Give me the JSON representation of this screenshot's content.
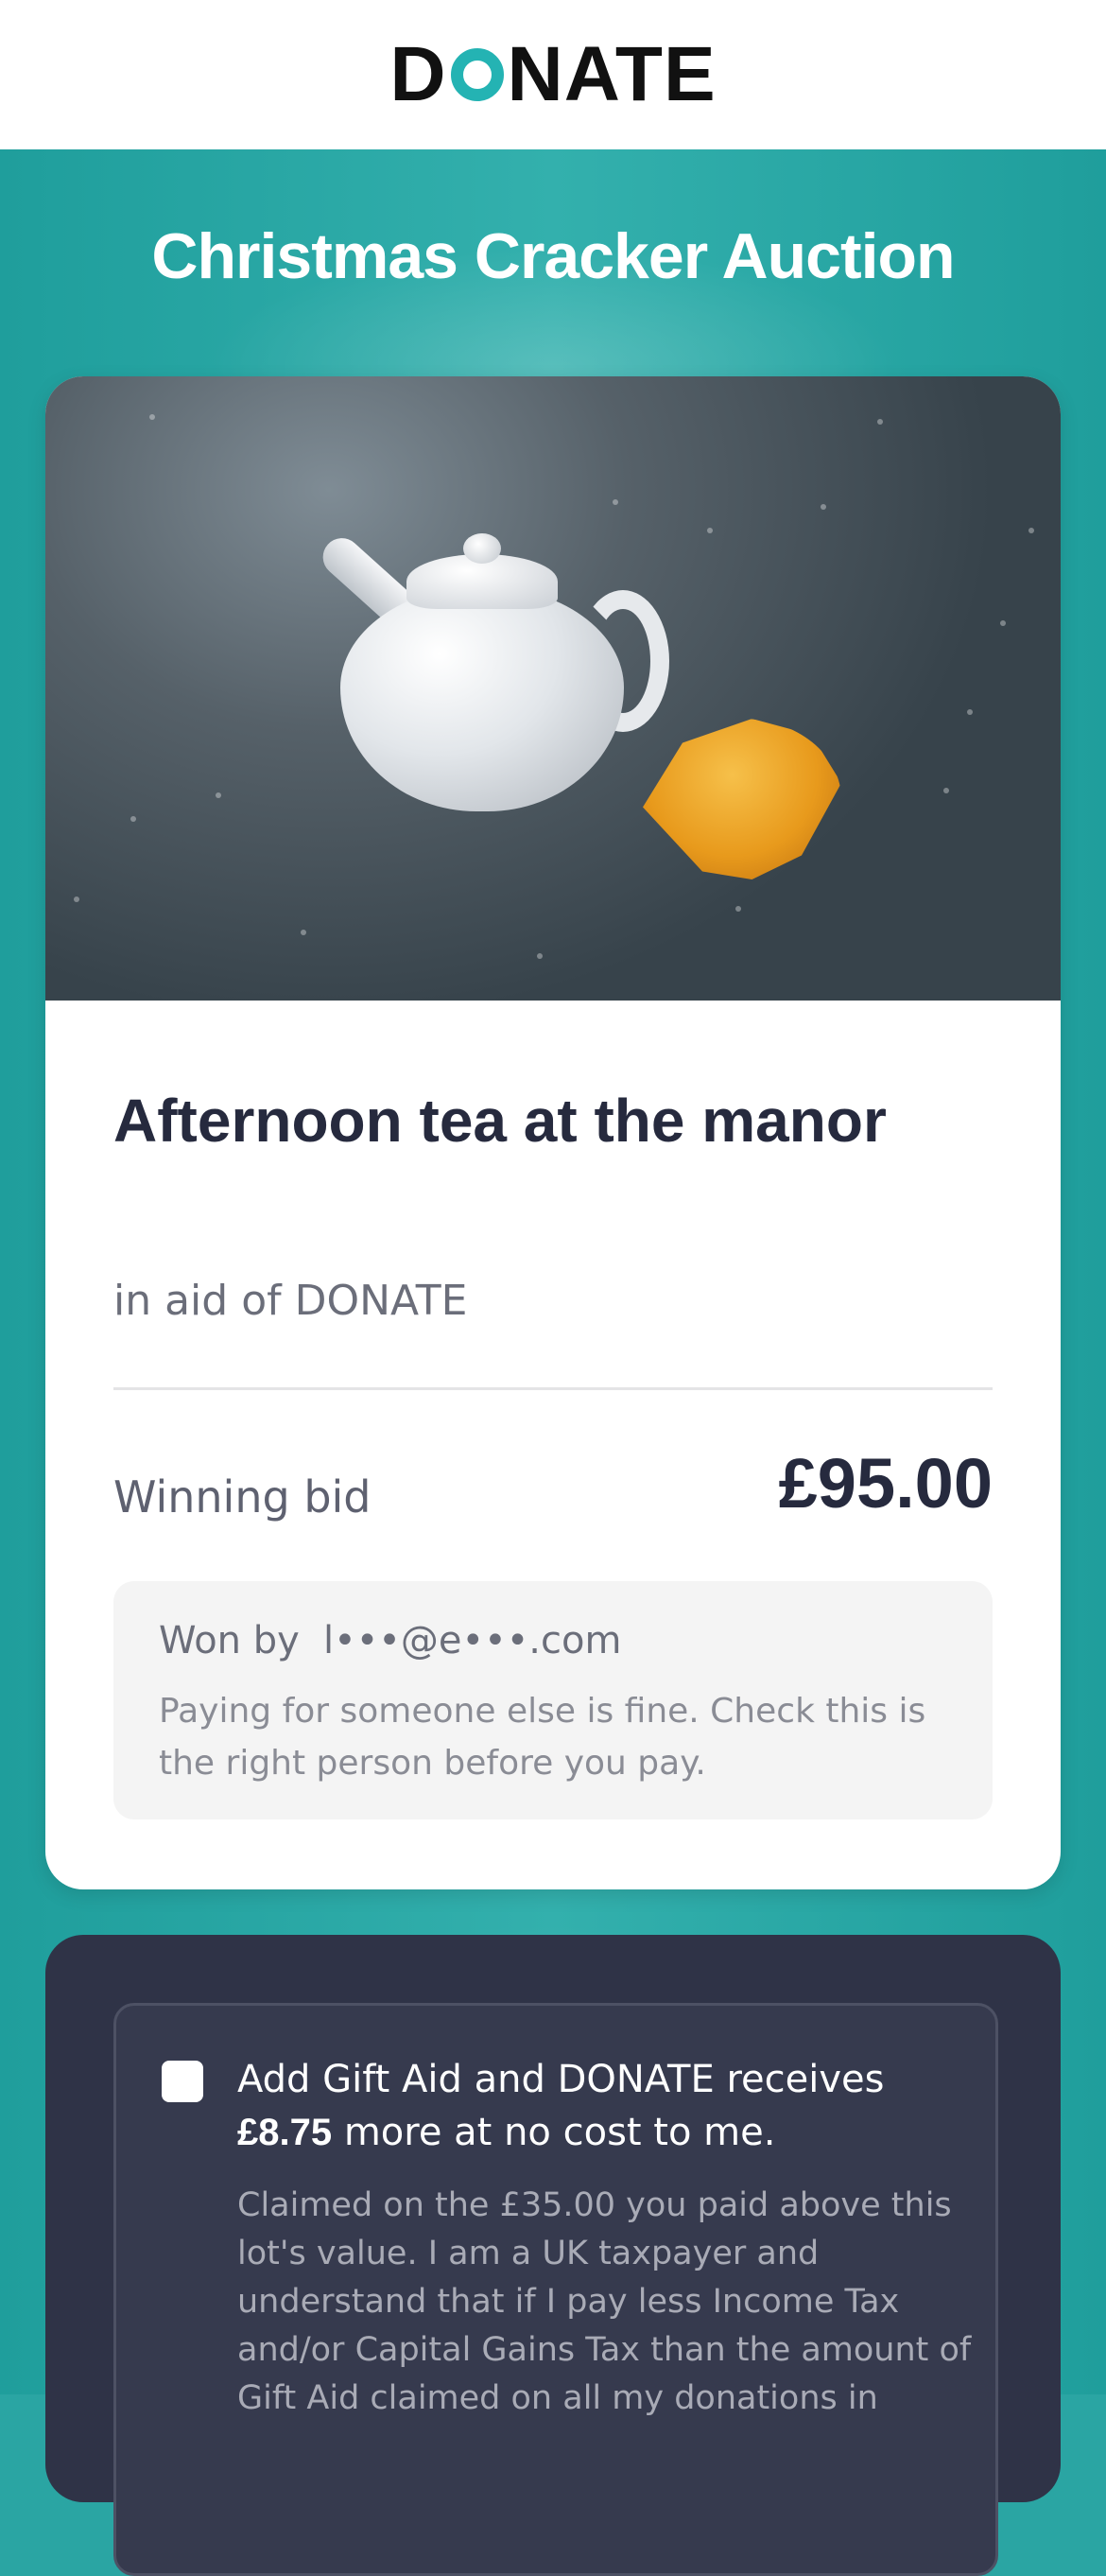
{
  "header": {
    "logo_text": "DONATE",
    "logo_accent_color": "#24b3b3"
  },
  "page": {
    "title": "Christmas Cracker Auction"
  },
  "lot": {
    "image_description_icons": [
      "teapot-icon",
      "croissant-icon"
    ],
    "title": "Afternoon tea at the manor",
    "in_aid": "in aid of DONATE",
    "winning_bid_label": "Winning bid",
    "winning_bid_value": "£95.00",
    "won_by_label": "Won by",
    "won_by_email": "l•••@e•••.com",
    "won_note": "Paying for someone else is fine. Check this is the right person before you pay."
  },
  "gift_aid": {
    "checked": false,
    "line_start": "Add Gift Aid and DONATE receives",
    "amount": "£8.75",
    "line_end": "more at no cost to me.",
    "details": "Claimed on the £35.00 you paid above this lot's value. I am a UK taxpayer and understand that if I pay less Income Tax and/or Capital Gains Tax than the amount of Gift Aid claimed on all my donations in"
  },
  "colors": {
    "teal": "#2aa5a3",
    "dark_navy": "#262a3e",
    "dark_card": "#2f3347"
  }
}
